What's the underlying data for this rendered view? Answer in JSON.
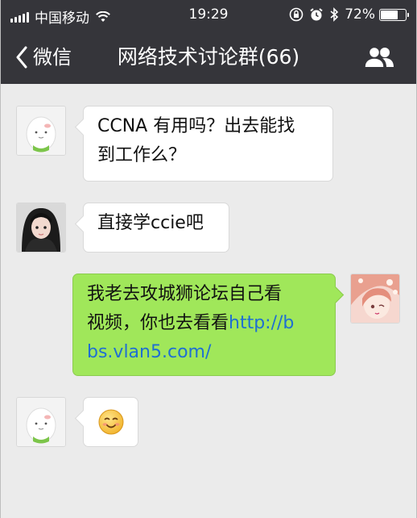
{
  "status_bar": {
    "carrier": "中国移动",
    "time": "19:29",
    "battery_percent_label": "72%",
    "battery_level": 0.72
  },
  "nav": {
    "back_label": "微信",
    "title": "网络技术讨论群(66)"
  },
  "messages": [
    {
      "direction": "in",
      "avatar": "cartoon-egg-avatar",
      "text_lines": [
        "CCNA 有用吗？出去能找",
        "到工作么？"
      ]
    },
    {
      "direction": "in",
      "avatar": "girl-photo-avatar",
      "text": "直接学ccie吧"
    },
    {
      "direction": "out",
      "avatar": "anime-girl-avatar",
      "text_line1": "我老去攻城狮论坛自己看",
      "text_line2_prefix": "视频，你也去看看",
      "link_part1": "http://b",
      "link_part2": "bs.vlan5.com/"
    },
    {
      "direction": "in",
      "avatar": "cartoon-egg-avatar",
      "emoji": "😊",
      "emoji_name": "smile-emoji"
    }
  ],
  "colors": {
    "bar": "#35353a",
    "chat_bg": "#ebebeb",
    "outgoing_bubble": "#a0e75a",
    "link": "#1f6fd2"
  }
}
